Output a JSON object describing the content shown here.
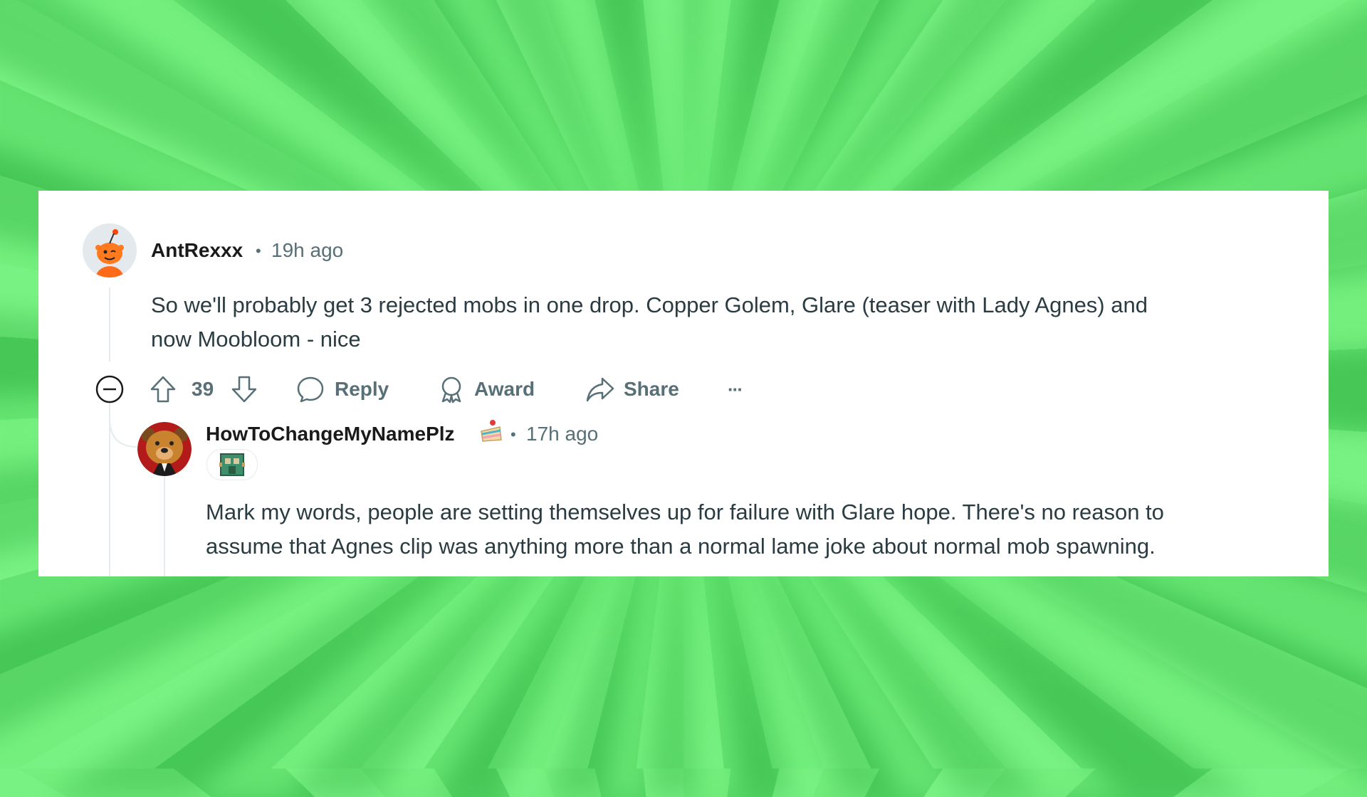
{
  "comments": [
    {
      "author": "AntRexxx",
      "separator": "•",
      "time": "19h ago",
      "text_line1": "So we'll probably get 3 rejected mobs in one drop. Copper Golem, Glare (teaser with Lady Agnes) and",
      "text_line2": "now Moobloom - nice"
    },
    {
      "author": "HowToChangeMyNamePlz",
      "separator": "•",
      "time": "17h ago",
      "text_line1": "Mark my words, people are setting themselves up for failure with Glare hope. There's no reason to",
      "text_line2": "assume that Agnes clip was anything more than a normal lame joke about normal mob spawning."
    }
  ],
  "actions": {
    "vote_count": "39",
    "reply_label": "Reply",
    "award_label": "Award",
    "share_label": "Share",
    "more_label": "···"
  },
  "colors": {
    "background_green": "#6fe97a",
    "card": "#ffffff",
    "username": "#1a1a1b",
    "meta": "#576f76",
    "snoo_orange": "#ff4500"
  },
  "icons": [
    "collapse-icon",
    "upvote-icon",
    "downvote-icon",
    "reply-icon",
    "award-icon",
    "share-icon",
    "more-icon",
    "cake-icon",
    "flair-icon"
  ]
}
